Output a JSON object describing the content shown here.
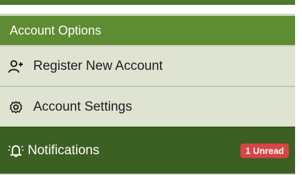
{
  "panel": {
    "header": "Account Options",
    "items": [
      {
        "label": "Register New Account",
        "icon": "add-user-icon"
      },
      {
        "label": "Account Settings",
        "icon": "gear-icon"
      },
      {
        "label": "Notifications",
        "icon": "bell-icon",
        "badge": "1 Unread",
        "active": true
      }
    ]
  },
  "colors": {
    "header_bg": "#5e8c32",
    "item_bg": "#dfe3d2",
    "active_bg": "#3c5f23",
    "badge_bg": "#d94444"
  }
}
